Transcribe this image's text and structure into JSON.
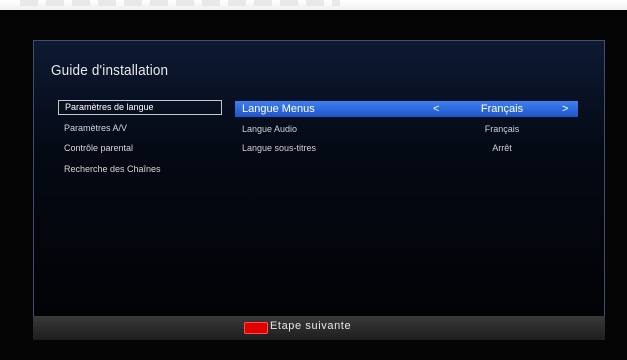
{
  "title": "Guide d'installation",
  "menu": [
    {
      "label": "Paramètres de langue",
      "active": true
    },
    {
      "label": "Paramètres A/V",
      "active": false
    },
    {
      "label": "Contrôle parental",
      "active": false
    },
    {
      "label": "Recherche des Chaînes",
      "active": false
    }
  ],
  "settings": [
    {
      "label": "Langue Menus",
      "value": "Français",
      "selected": true
    },
    {
      "label": "Langue Audio",
      "value": "Français",
      "selected": false
    },
    {
      "label": "Langue sous-titres",
      "value": "Arrêt",
      "selected": false
    }
  ],
  "arrows": {
    "left": "<",
    "right": ">"
  },
  "footer": {
    "next_label": "Etape suivante",
    "key_color": "#e00000"
  },
  "colors": {
    "selection": "#2f6ee6",
    "background": "#050505"
  }
}
